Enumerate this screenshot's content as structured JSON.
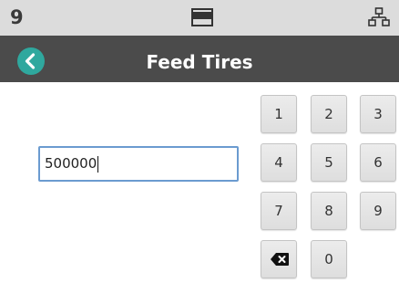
{
  "status_bar": {
    "number": "9",
    "center_icon": "display-icon",
    "right_icon": "network-icon"
  },
  "header": {
    "title": "Feed Tires",
    "back_icon": "back-arrow-icon"
  },
  "input": {
    "value": "500000"
  },
  "keypad": {
    "keys": [
      "1",
      "2",
      "3",
      "4",
      "5",
      "6",
      "7",
      "8",
      "9",
      "0"
    ],
    "backspace_icon": "backspace-icon"
  },
  "colors": {
    "status_bar_bg": "#dcdcdc",
    "header_bg": "#4b4b4b",
    "accent": "#2fa89e",
    "input_border": "#6b9bd0"
  }
}
